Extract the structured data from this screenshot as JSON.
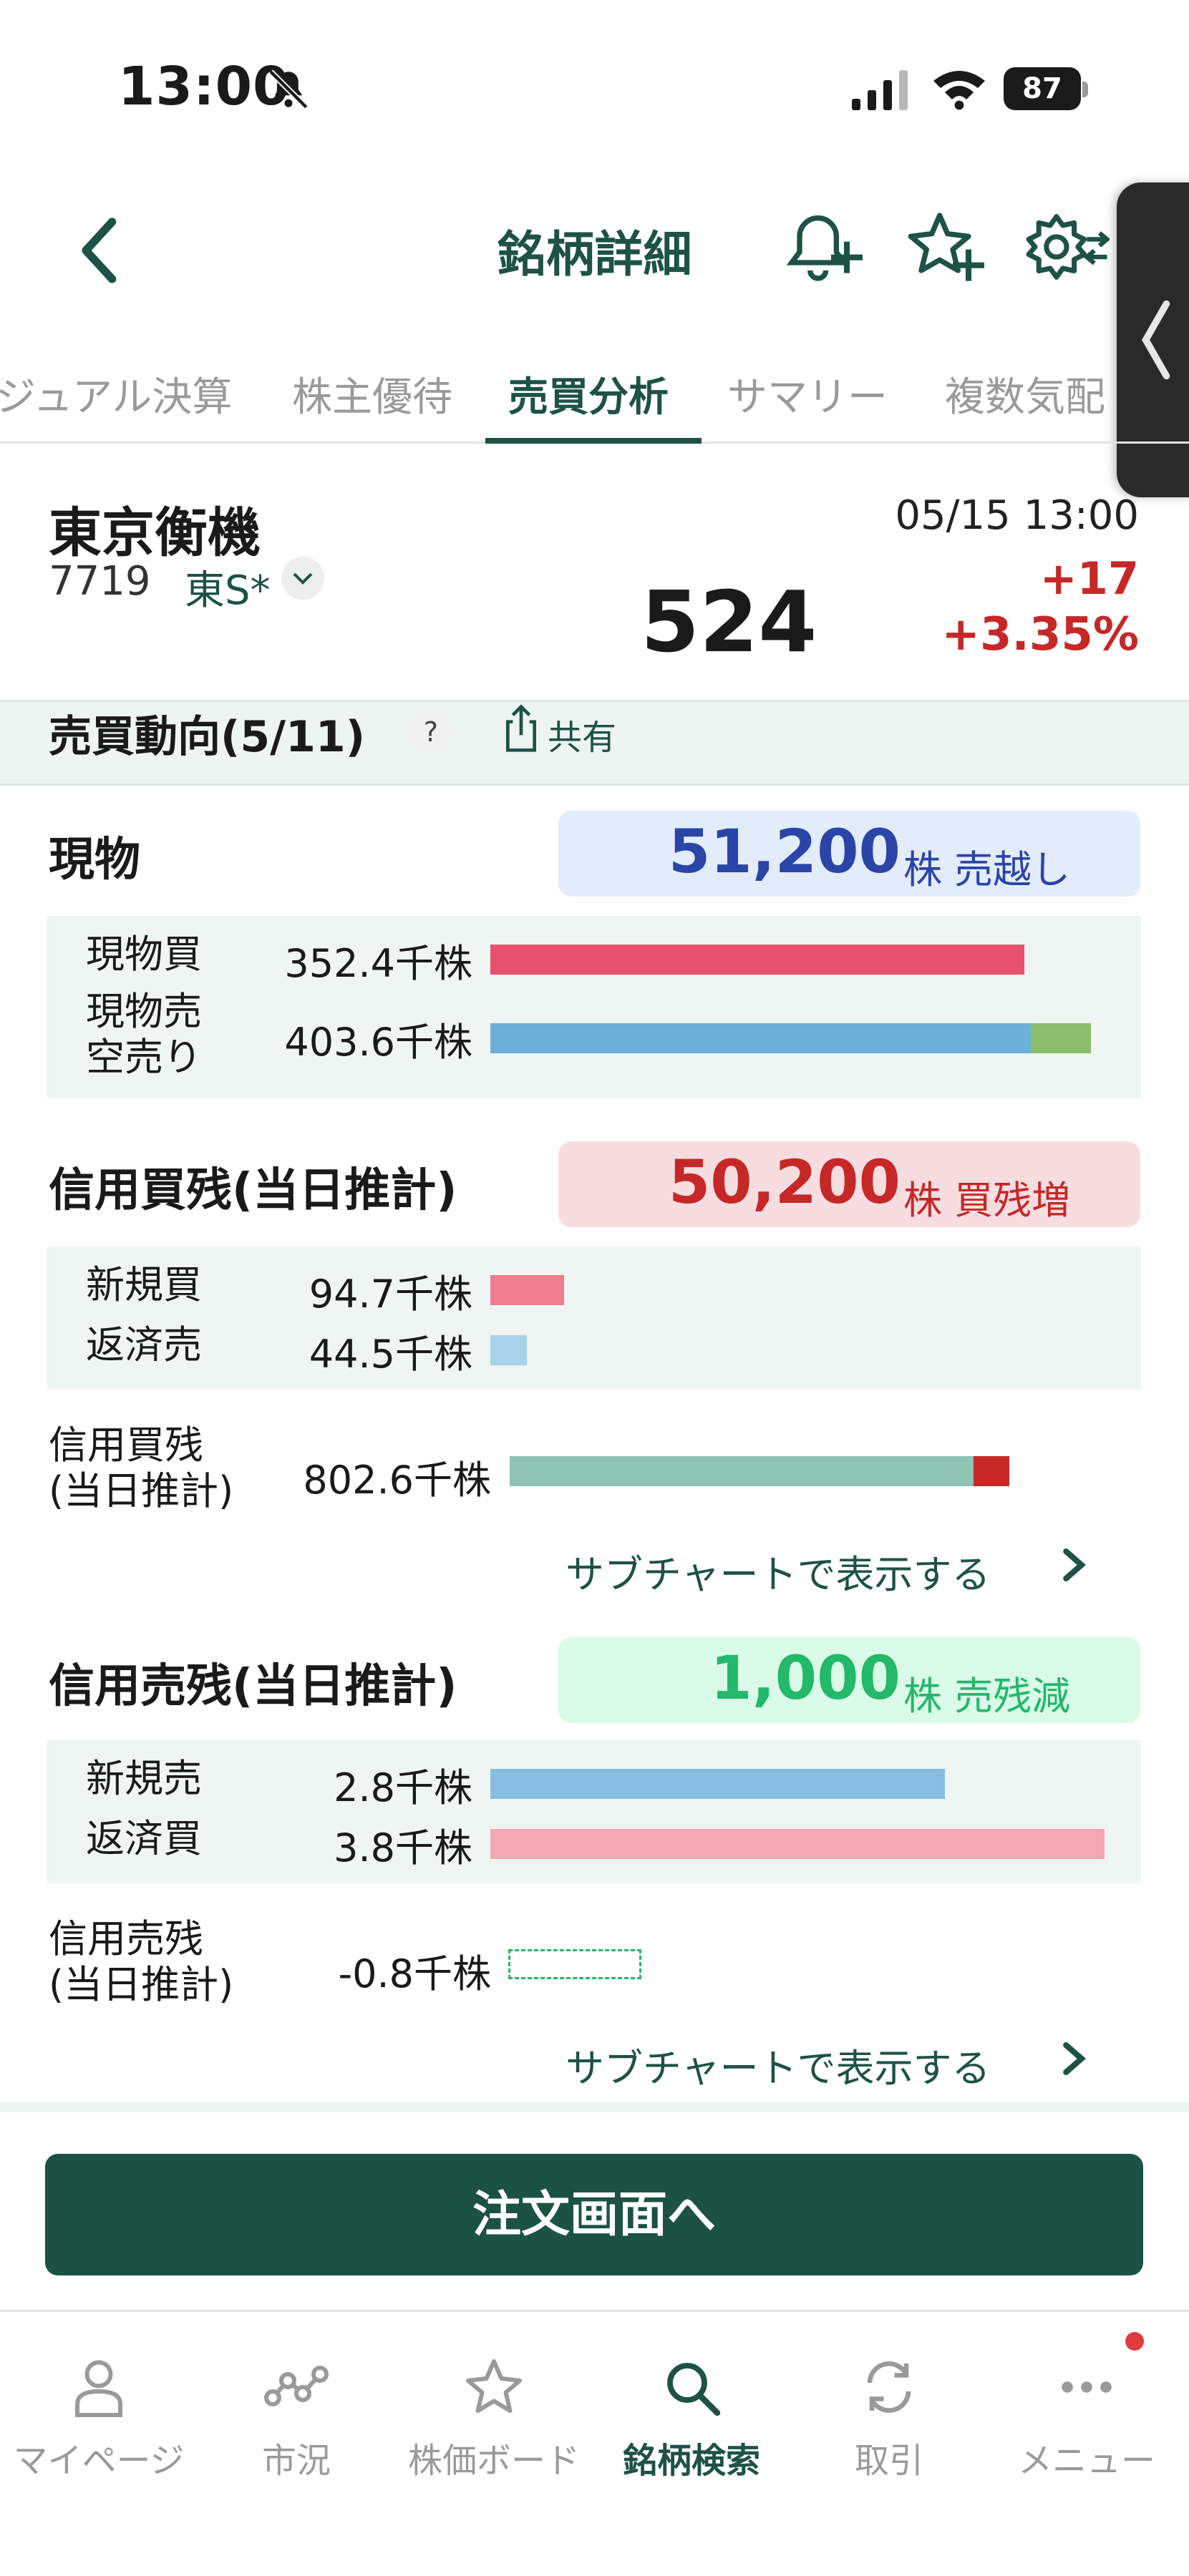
{
  "status_bar": {
    "time": "13:00",
    "battery": "87"
  },
  "header": {
    "title": "銘柄詳細"
  },
  "tabs": [
    {
      "label": "ジュアル決算",
      "active": false
    },
    {
      "label": "株主優待",
      "active": false
    },
    {
      "label": "売買分析",
      "active": true
    },
    {
      "label": "サマリー",
      "active": false
    },
    {
      "label": "複数気配",
      "active": false
    }
  ],
  "stock": {
    "name": "東京衡機",
    "code": "7719",
    "market": "東S*",
    "datetime": "05/15 13:00",
    "price": "524",
    "change": "+17",
    "change_pct": "+3.35%"
  },
  "trend": {
    "title": "売買動向(5/11)",
    "help": "?",
    "share_label": "共有"
  },
  "spot": {
    "title": "現物",
    "summary_value": "51,200",
    "summary_unit": "株 売越し",
    "rows": [
      {
        "label": "現物買",
        "value": "352.4千株",
        "bar_fraction": 0.87,
        "color": "#e8516d"
      },
      {
        "label": "現物売\n空売り",
        "value": "403.6千株",
        "bar_fraction": 0.88,
        "extra_fraction": 0.12,
        "color": "#6ab0d8",
        "extra_color": "#8bbd6c"
      }
    ]
  },
  "margin_buy": {
    "title": "信用買残(当日推計)",
    "summary_value": "50,200",
    "summary_unit": "株 買残増",
    "rows": [
      {
        "label": "新規買",
        "value": "94.7千株",
        "bar_fraction": 0.12,
        "color": "#ee7d8d"
      },
      {
        "label": "返済売",
        "value": "44.5千株",
        "bar_fraction": 0.06,
        "color": "#a8d3ea"
      }
    ],
    "balance_label": "信用買残\n(当日推計)",
    "balance_value": "802.6千株",
    "balance_fraction": 0.94,
    "balance_increase_fraction": 0.06,
    "sub_link": "サブチャートで表示する"
  },
  "margin_sell": {
    "title": "信用売残(当日推計)",
    "summary_value": "1,000",
    "summary_unit": "株 売残減",
    "rows": [
      {
        "label": "新規売",
        "value": "2.8千株",
        "bar_fraction": 0.74,
        "color": "#86bde0"
      },
      {
        "label": "返済買",
        "value": "3.8千株",
        "bar_fraction": 1.0,
        "color": "#f3a8b2"
      }
    ],
    "balance_label": "信用売残\n(当日推計)",
    "balance_value": "-0.8千株",
    "sub_link": "サブチャートで表示する"
  },
  "order_button": "注文画面へ",
  "bottom_nav": [
    {
      "label": "マイページ",
      "icon": "person-icon",
      "active": false
    },
    {
      "label": "市況",
      "icon": "market-icon",
      "active": false
    },
    {
      "label": "株価ボード",
      "icon": "star-icon",
      "active": false
    },
    {
      "label": "銘柄検索",
      "icon": "search-icon",
      "active": true
    },
    {
      "label": "取引",
      "icon": "refresh-icon",
      "active": false
    },
    {
      "label": "メニュー",
      "icon": "more-icon",
      "active": false
    }
  ],
  "colors": {
    "brand": "#1d5245",
    "up": "#c62828",
    "sell_summary": "#2a44a8",
    "buy_increase": "#c62828",
    "sell_decrease": "#23b86a",
    "margin_balance": "#8ec3b4"
  }
}
